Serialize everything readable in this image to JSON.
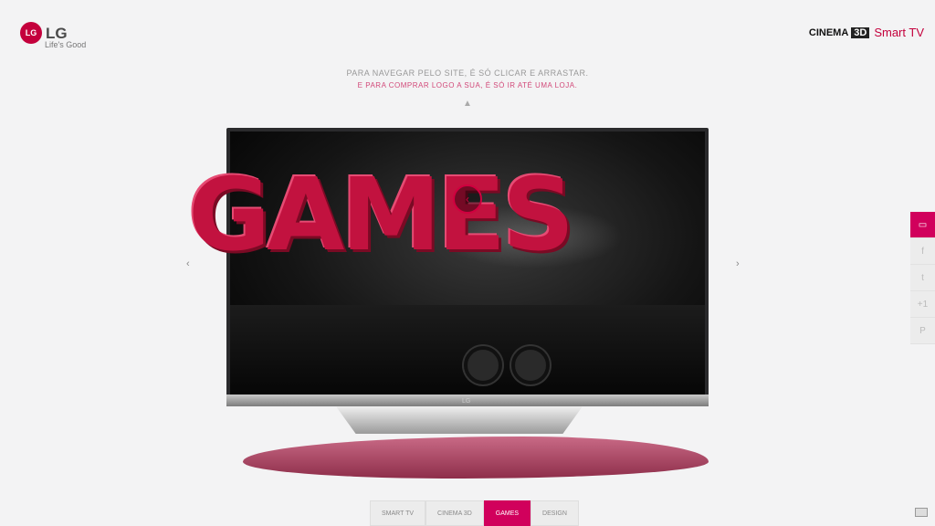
{
  "header": {
    "logo_badge": "LG",
    "logo_wordmark": "LG",
    "logo_tagline": "Life's Good",
    "brand_cinema": "CINEMA",
    "brand_3d": "3D",
    "brand_smart_tv": "Smart TV"
  },
  "hints": {
    "line1": "PARA NAVEGAR PELO SITE, É SÓ CLICAR E ARRASTAR.",
    "line2": "E PARA COMPRAR LOGO A SUA, É SÓ IR ATÉ UMA LOJA."
  },
  "tv": {
    "hero_text": "GAMES",
    "tv_logo": "LG"
  },
  "nav": {
    "prev": "‹",
    "next": "›",
    "center_back": "‹"
  },
  "share": [
    {
      "name": "email",
      "glyph": "▭"
    },
    {
      "name": "facebook",
      "glyph": "f"
    },
    {
      "name": "twitter",
      "glyph": "t"
    },
    {
      "name": "google-plus",
      "glyph": "+1"
    },
    {
      "name": "pinterest",
      "glyph": "P"
    }
  ],
  "tabs": [
    {
      "label": "SMART TV",
      "active": false
    },
    {
      "label": "CINEMA 3D",
      "active": false
    },
    {
      "label": "GAMES",
      "active": true
    },
    {
      "label": "DESIGN",
      "active": false
    }
  ],
  "colors": {
    "accent": "#d1005c",
    "brand_red": "#c4003c"
  }
}
